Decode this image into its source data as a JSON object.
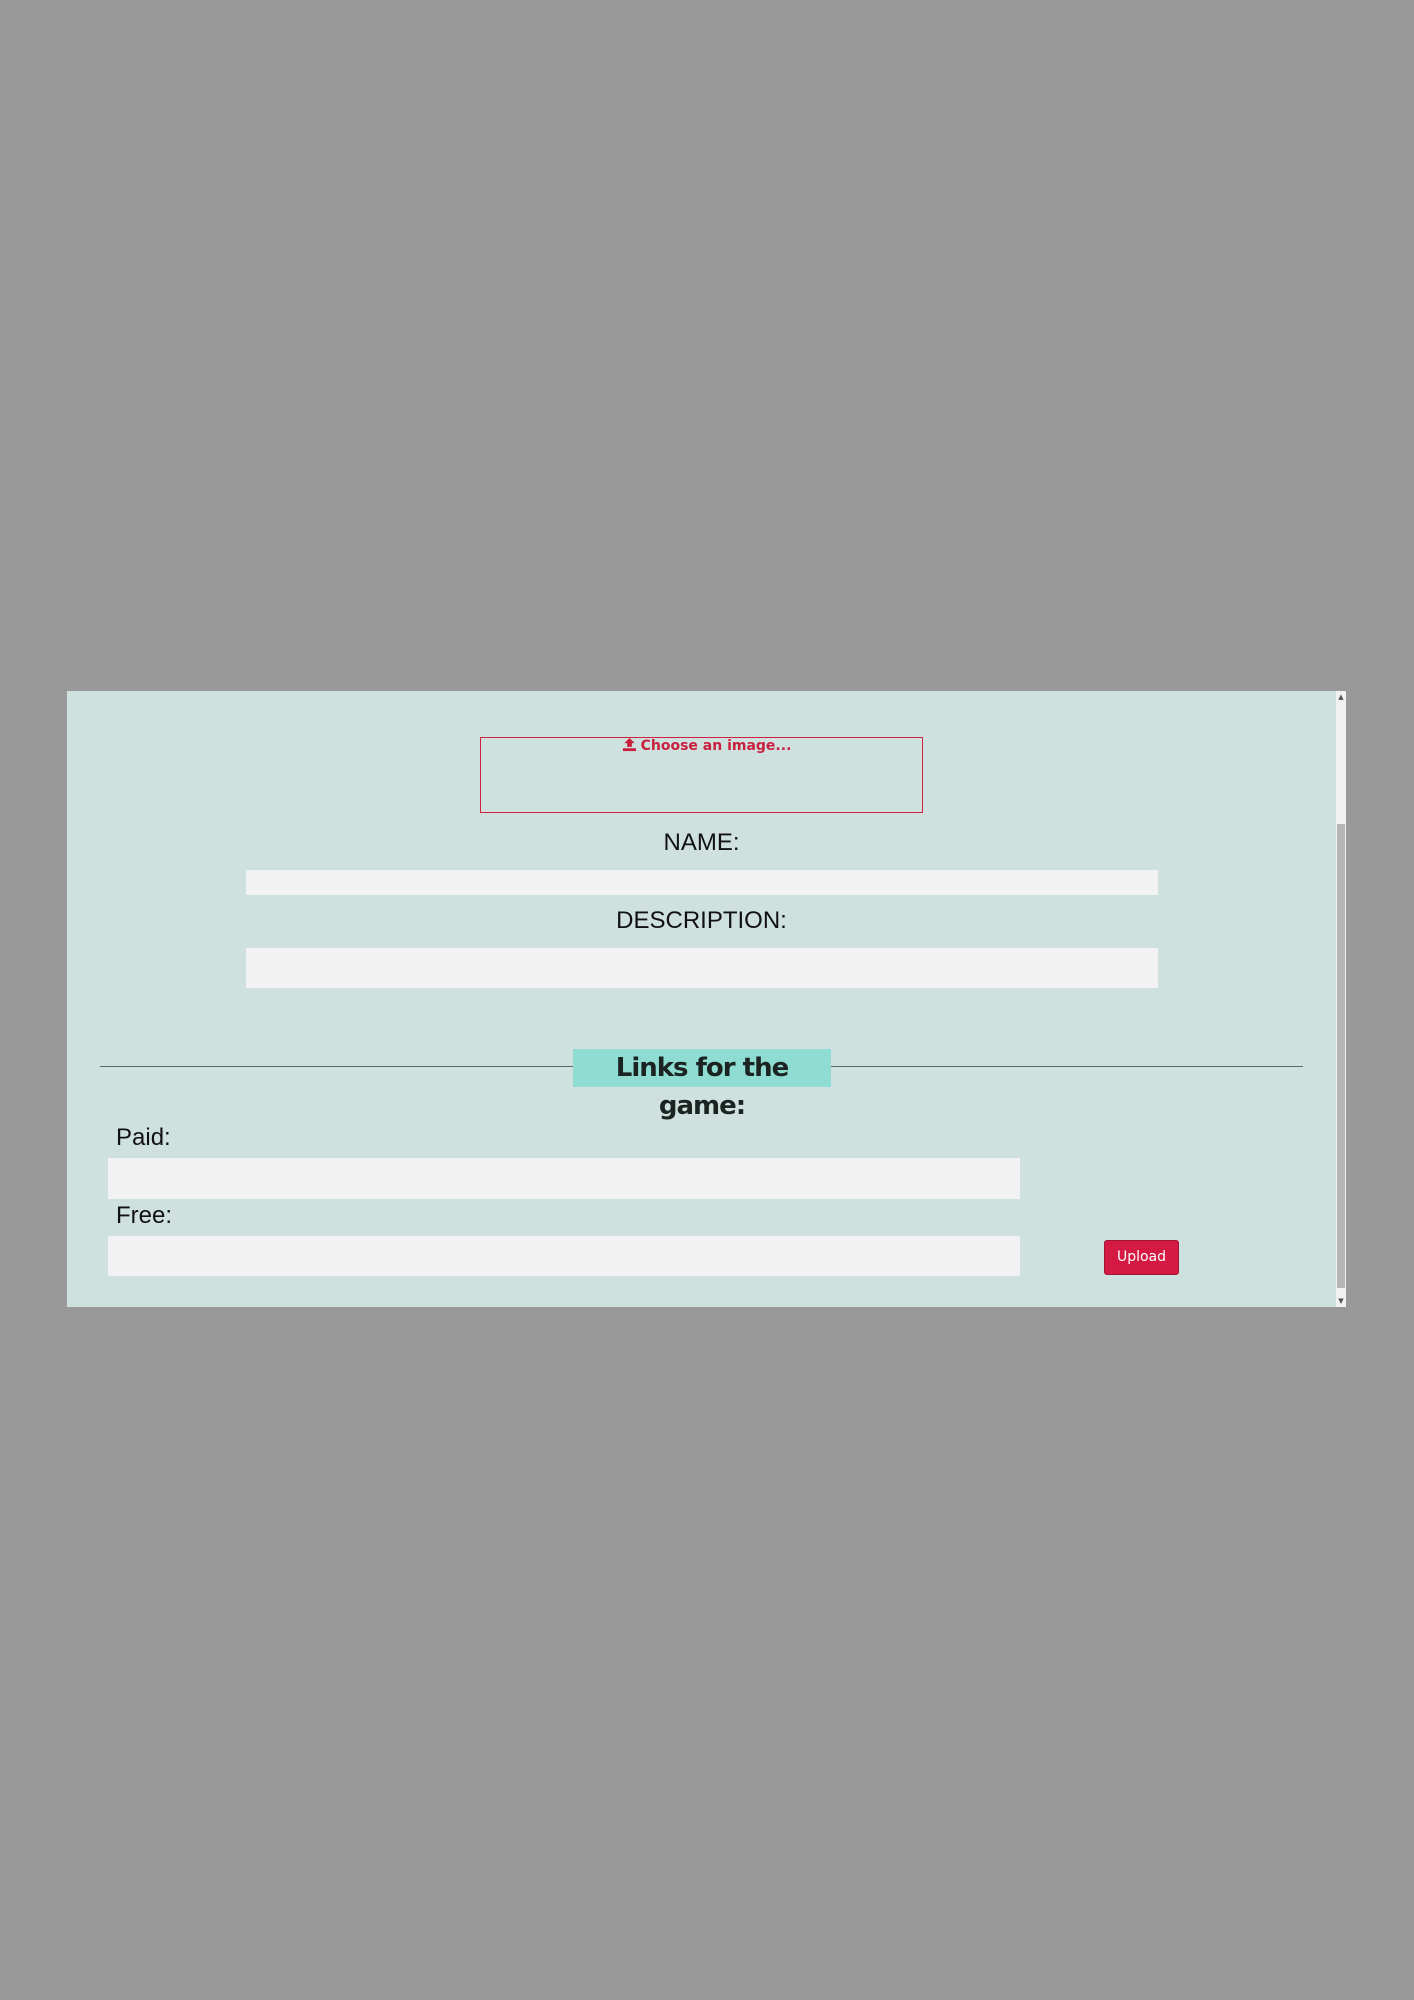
{
  "upload_box": {
    "choose_label": "Choose an image...",
    "icon": "upload-icon"
  },
  "fields": {
    "name_label": "NAME:",
    "name_value": "",
    "description_label": "DESCRIPTION:",
    "description_value": ""
  },
  "links_section": {
    "title": "Links for the game:",
    "paid_label": "Paid:",
    "paid_value": "",
    "free_label": "Free:",
    "free_value": ""
  },
  "actions": {
    "upload_label": "Upload"
  },
  "colors": {
    "page_background": "#999999",
    "modal_background": "#cfe1df",
    "accent": "#d41a43",
    "section_title_background": "#8edcd2",
    "input_background": "#f2f2f2"
  }
}
